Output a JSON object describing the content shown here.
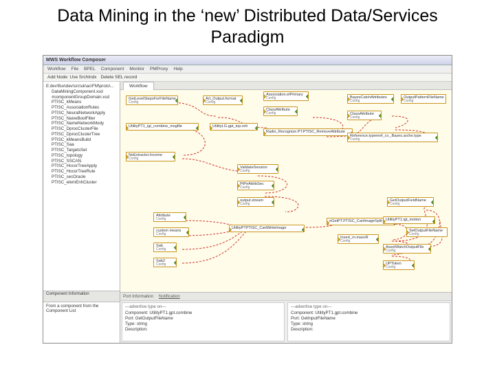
{
  "slide": {
    "title": "Data Mining in the ‘new’ Distributed Data/Services Paradigm"
  },
  "window": {
    "title": "MWS Workflow Composer"
  },
  "menu": {
    "items": [
      "Workflow",
      "File",
      "BPEL",
      "Component",
      "Monitor",
      "PMProxy",
      "Help"
    ]
  },
  "toolbar": {
    "addNode": "Add Node: Use SrchIndx",
    "delNode": "Delete SEL record"
  },
  "tree": {
    "header": "E:dev\\flux\\dev\\src\\uk\\ac\\FM\\proto\\...",
    "sub": "DataMiningComponent.xsd",
    "sub2": "#componentGroupDomain.xsd",
    "items": [
      "PTISC_kMeans",
      "PTISC_AssociationRules",
      "PTISC_NeuralNetworkApply",
      "PTISC_NaiveBoolFilter",
      "PTISC_NameNetworkMody",
      "PTISC_DprocClusterFile",
      "PTISC_DprocClusterTree",
      "PTISC_kMeansBuild",
      "PTISC_Saa",
      "PTISC_TargetsSet",
      "PTISC_topology",
      "PTISC_SSCAN",
      "PTISC_HocorTreeApply",
      "PTISC_HocorTreeRule",
      "PTISC_secOracle",
      "PTISC_elemEnhCluster"
    ]
  },
  "compInfoLabel": "Component Information",
  "compListHeader": "From a component from the",
  "compListLabel": "Component List",
  "canvasTab": "Workflow",
  "nodes": {
    "n1": {
      "label": "GetLevelStepsForFileName",
      "cfg": "Config"
    },
    "n2": {
      "label": "Art_Output.format",
      "cfg": "Config"
    },
    "n3": {
      "label": "Association.elPrimary",
      "cfg": "Config"
    },
    "n4": {
      "label": "ClassAttribute",
      "cfg": "Config"
    },
    "n5": {
      "label": "BayesCatchAttributes",
      "cfg": "Config"
    },
    "n6": {
      "label": "OutputPatternFileName",
      "cfg": "Config"
    },
    "n7": {
      "label": "ClassAttribute",
      "cfg": "Config"
    },
    "n8": {
      "label": "UtilityPT1_igt_combine_msgfile"
    },
    "n9": {
      "label": "UtilityLG.gpt_top.ortt"
    },
    "n10": {
      "label": "Radio_Recognize.PT.PTISC_RemoveAttribute"
    },
    "n11": {
      "label": "Reference.typenref_cv._Bayes.arche.type",
      "cfg": "Config"
    },
    "n12": {
      "label": "NoExtractor.Income",
      "cfg": "Config"
    },
    "n13": {
      "label": "ValidateSession",
      "cfg": "Config"
    },
    "n14": {
      "label": "PtPeAttribSec",
      "cfg": "Config"
    },
    "n15": {
      "label": "output.stream",
      "cfg": "Config"
    },
    "n16": {
      "label": "Attribute",
      "cfg": "Config"
    },
    "n17": {
      "label": "custom means",
      "cfg": "Config"
    },
    "n18": {
      "label": "Sab",
      "cfg": "Config"
    },
    "n19": {
      "label": "Sab2",
      "cfg": "Config"
    },
    "n20": {
      "label": "UtilityPTPTISC_CartWriteImage"
    },
    "n21": {
      "label": "eGetPT.PTISC_CartImageSplit"
    },
    "n22": {
      "label": "Insert_m.maxvR",
      "cfg": "Config"
    },
    "n23": {
      "label": "GetOutputFieldName",
      "cfg": "Config"
    },
    "n24": {
      "label": "UtilityPT1.igt_motion"
    },
    "n25": {
      "label": "SetOutputFileName",
      "cfg": "Config"
    },
    "n26": {
      "label": "AssetWatchOutputFile",
      "cfg": "Config"
    },
    "n27": {
      "label": "UPToken",
      "cfg": "Config"
    }
  },
  "bottom": {
    "tabs": [
      "Port Information",
      "Notification"
    ],
    "left": {
      "hd": "—advertise type on—",
      "l1": "Component: UtilityPT1.gpt.combine",
      "l2": "Port: GetOutputFileName",
      "l3": "Type: string",
      "l4": "Description:"
    },
    "right": {
      "hd": "—advertise type on—",
      "l1": "Component: UtilityPT1.gpt.combine",
      "l2": "Port: GetInputFileName",
      "l3": "Type: string",
      "l4": "Description:"
    }
  }
}
